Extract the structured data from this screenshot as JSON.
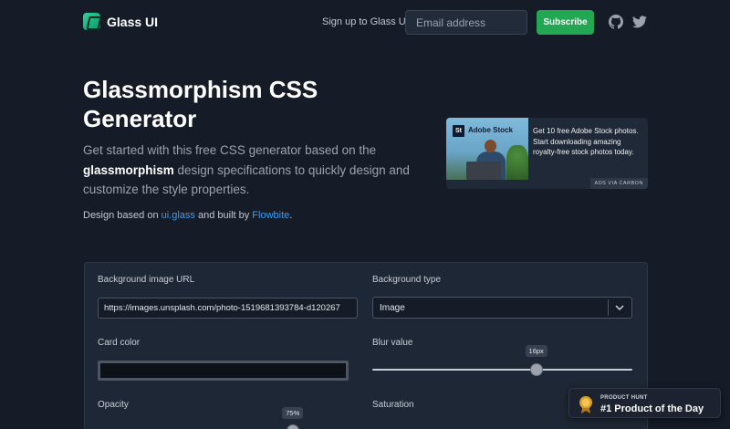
{
  "header": {
    "logo_text": "Glass UI",
    "signup_label": "Sign up to Glass UI:",
    "email_placeholder": "Email address",
    "subscribe_label": "Subscribe",
    "icons": [
      "github-icon",
      "twitter-icon"
    ]
  },
  "hero": {
    "title": "Glassmorphism CSS Generator",
    "desc_before": "Get started with this free CSS generator based on the ",
    "desc_bold": "glassmorphism",
    "desc_after": " design specifications to quickly design and customize the style properties.",
    "credits_prefix": "Design based on ",
    "credits_link1": "ui.glass",
    "credits_middle": " and built by ",
    "credits_link2": "Flowbite",
    "credits_suffix": "."
  },
  "ad": {
    "badge": "St",
    "brand": "Adobe Stock",
    "text": "Get 10 free Adobe Stock photos. Start downloading amazing royalty-free stock photos today.",
    "via": "ADS VIA CARBON"
  },
  "generator": {
    "bg_url_label": "Background image URL",
    "bg_url_value": "https://images.unsplash.com/photo-1519681393784-d120267",
    "bg_type_label": "Background type",
    "bg_type_value": "Image",
    "card_color_label": "Card color",
    "blur_label": "Blur value",
    "blur_value": "16px",
    "blur_fraction": 0.63,
    "opacity_label": "Opacity",
    "opacity_value": "75%",
    "opacity_fraction": 0.75,
    "saturation_label": "Saturation"
  },
  "product_hunt": {
    "kicker": "PRODUCT HUNT",
    "title": "#1 Product of the Day"
  },
  "colors": {
    "background": "#151c28",
    "panel": "#1e2735",
    "accent_green": "#22a753",
    "link_blue": "#3b9bf0"
  }
}
